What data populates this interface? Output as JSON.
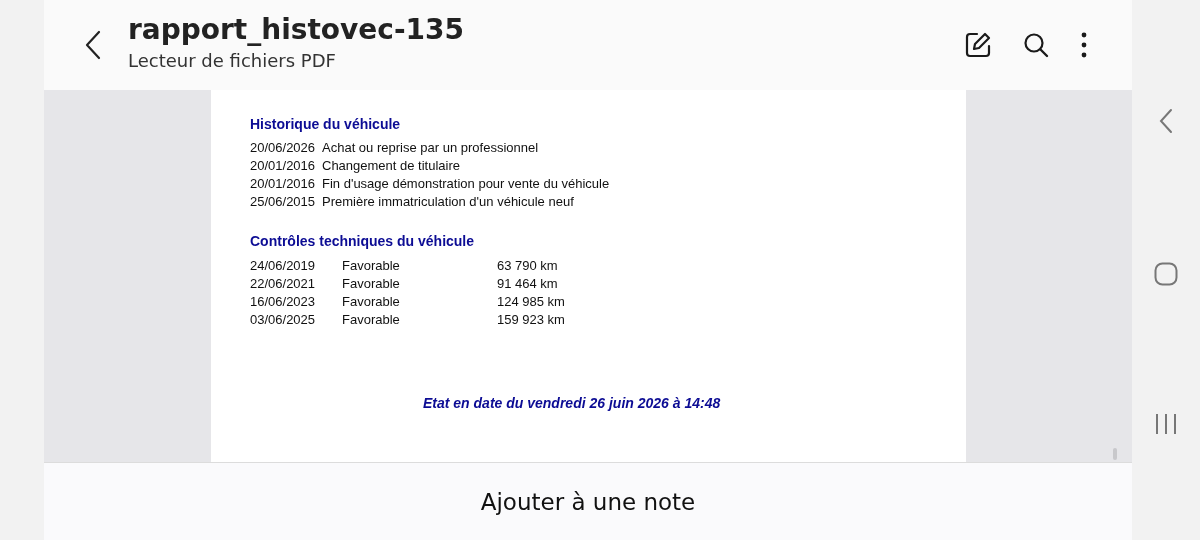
{
  "header": {
    "title": "rapport_histovec-135",
    "subtitle": "Lecteur de fichiers PDF"
  },
  "document": {
    "history": {
      "heading": "Historique du véhicule",
      "rows": [
        {
          "date": "20/06/2026",
          "event": "Achat ou reprise par un professionnel"
        },
        {
          "date": "20/01/2016",
          "event": "Changement de titulaire"
        },
        {
          "date": "20/01/2016",
          "event": "Fin d'usage démonstration pour vente du véhicule"
        },
        {
          "date": "25/06/2015",
          "event": "Première immatriculation d'un véhicule neuf"
        }
      ]
    },
    "inspections": {
      "heading": "Contrôles techniques du véhicule",
      "rows": [
        {
          "date": "24/06/2019",
          "result": "Favorable",
          "mileage": "63 790 km"
        },
        {
          "date": "22/06/2021",
          "result": "Favorable",
          "mileage": "91 464 km"
        },
        {
          "date": "16/06/2023",
          "result": "Favorable",
          "mileage": "124 985 km"
        },
        {
          "date": "03/06/2025",
          "result": "Favorable",
          "mileage": "159 923 km"
        }
      ]
    },
    "footer": "Etat en date du vendredi 26 juin 2026 à 14:48"
  },
  "bottom_bar": {
    "action": "Ajouter à une note"
  }
}
